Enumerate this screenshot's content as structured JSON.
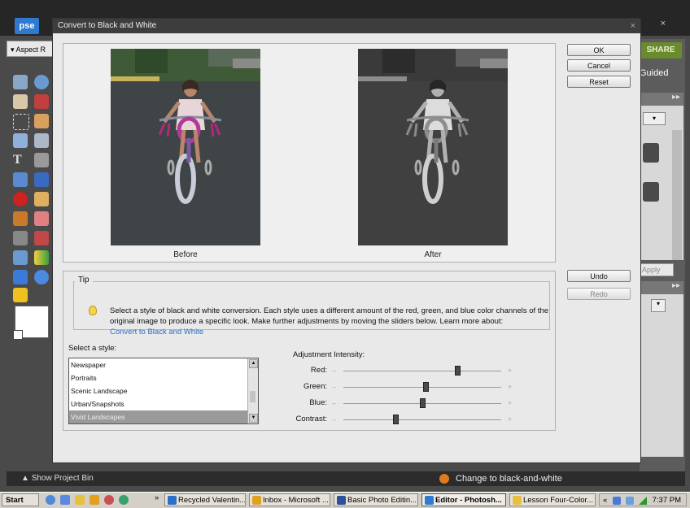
{
  "app": {
    "logo": "pse",
    "option_bar_text": "Aspect R",
    "share_label": "SHARE",
    "guided_label": "Guided",
    "apply_label": "Apply",
    "show_project_bin": "Show Project Bin",
    "status_action": "Change to black-and-white"
  },
  "dialog": {
    "title": "Convert to Black and White",
    "close_glyph": "×",
    "before_label": "Before",
    "after_label": "After",
    "buttons": {
      "ok": "OK",
      "cancel": "Cancel",
      "reset": "Reset",
      "undo": "Undo",
      "redo": "Redo"
    },
    "tip": {
      "legend": "Tip",
      "text": "Select a style of black and white conversion. Each style uses a different amount of the red, green, and blue color channels of the original image to produce a specific look. Make further adjustments by moving the sliders below. Learn more about:",
      "link": "Convert to Black and White"
    },
    "style_label": "Select a style:",
    "styles": [
      "Newspaper",
      "Portraits",
      "Scenic Landscape",
      "Urban/Snapshots",
      "Vivid Landscapes"
    ],
    "selected_style": "Vivid Landscapes",
    "adjustment_label": "Adjustment Intensity:",
    "sliders": [
      {
        "name": "Red:",
        "value": 0.72
      },
      {
        "name": "Green:",
        "value": 0.52
      },
      {
        "name": "Blue:",
        "value": 0.5
      },
      {
        "name": "Contrast:",
        "value": 0.33
      }
    ],
    "minus_glyph": "–",
    "plus_glyph": "+"
  },
  "taskbar": {
    "start": "Start",
    "chevron": "»",
    "tasks": [
      {
        "label": "Recycled Valentin...",
        "icon_color": "#2a6fc9",
        "active": false
      },
      {
        "label": "Inbox - Microsoft ...",
        "icon_color": "#e0a020",
        "active": false
      },
      {
        "label": "Basic Photo Editin...",
        "icon_color": "#2e4f9a",
        "active": false
      },
      {
        "label": "Editor - Photosh...",
        "icon_color": "#2e7ad1",
        "active": true
      },
      {
        "label": "Lesson Four-Color...",
        "icon_color": "#e8c040",
        "active": false
      }
    ],
    "tray_chevron": "«",
    "clock": "7:37 PM"
  },
  "colors": {
    "accent_link": "#2e6fc0",
    "share_green": "#6a8a2e",
    "status_orange": "#e07a1f"
  }
}
